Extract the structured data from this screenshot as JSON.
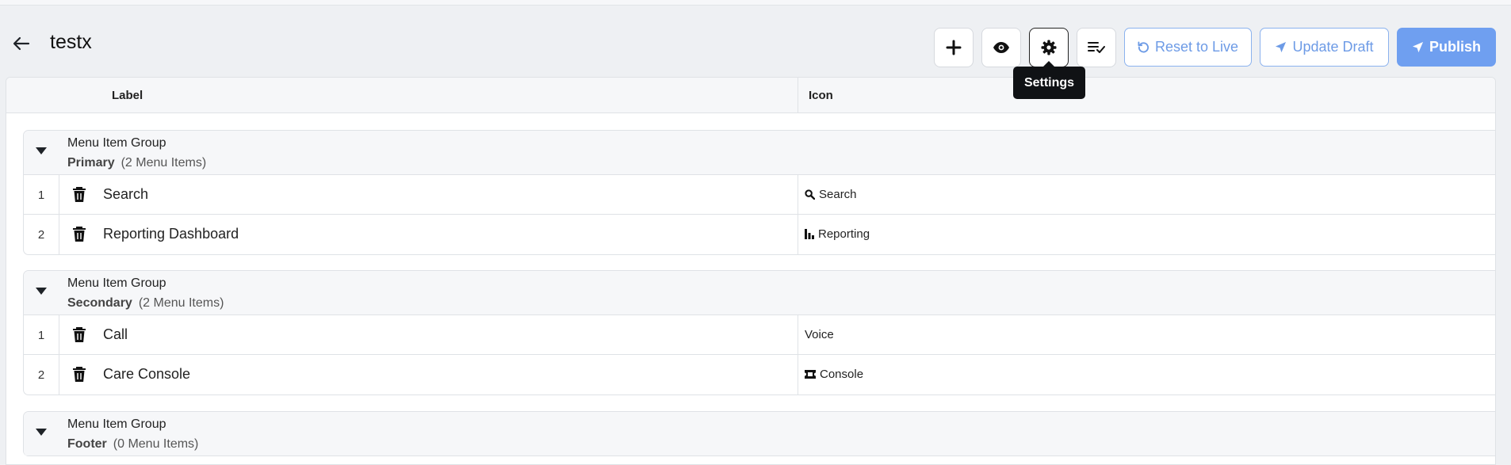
{
  "header": {
    "title": "testx",
    "reset_label": "Reset to Live",
    "update_label": "Update Draft",
    "publish_label": "Publish",
    "tooltip": "Settings"
  },
  "table": {
    "col_label": "Label",
    "col_icon": "Icon"
  },
  "groups": [
    {
      "title": "Menu Item Group",
      "name": "Primary",
      "count": "(2 Menu Items)",
      "rows": [
        {
          "num": "1",
          "label": "Search",
          "icon": "search-icon",
          "icon_text": "Search"
        },
        {
          "num": "2",
          "label": "Reporting Dashboard",
          "icon": "bar-chart-icon",
          "icon_text": "Reporting"
        }
      ]
    },
    {
      "title": "Menu Item Group",
      "name": "Secondary",
      "count": "(2 Menu Items)",
      "rows": [
        {
          "num": "1",
          "label": "Call",
          "icon": "",
          "icon_text": "Voice"
        },
        {
          "num": "2",
          "label": "Care Console",
          "icon": "ticket-icon",
          "icon_text": "Console"
        }
      ]
    },
    {
      "title": "Menu Item Group",
      "name": "Footer",
      "count": "(0 Menu Items)",
      "rows": []
    }
  ],
  "colors": {
    "primary": "#6f9ff0",
    "outline_text": "#6d9be6",
    "tooltip_bg": "#101215"
  }
}
